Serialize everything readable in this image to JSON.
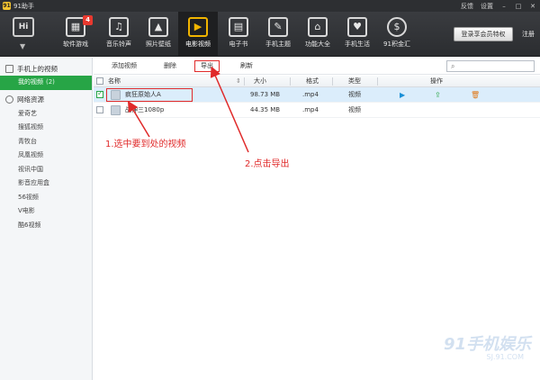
{
  "window": {
    "title": "91助手",
    "controls": [
      "反馈",
      "设置"
    ]
  },
  "toolbar": {
    "home_label": "Hi",
    "items": [
      {
        "label": "软件游戏",
        "icon": "apps-grid-icon",
        "glyph": "▦",
        "badge": "4"
      },
      {
        "label": "音乐铃声",
        "icon": "music-note-icon",
        "glyph": "♫"
      },
      {
        "label": "照片壁纸",
        "icon": "photo-icon",
        "glyph": "▲"
      },
      {
        "label": "电影视频",
        "icon": "film-icon",
        "glyph": "▶",
        "active": true
      },
      {
        "label": "电子书",
        "icon": "ebook-icon",
        "glyph": "▤"
      },
      {
        "label": "手机主题",
        "icon": "theme-icon",
        "glyph": "✎"
      },
      {
        "label": "功能大全",
        "icon": "tools-icon",
        "glyph": "⌂"
      },
      {
        "label": "手机生活",
        "icon": "heart-bag-icon",
        "glyph": "♥"
      },
      {
        "label": "91积金汇",
        "icon": "coin-icon",
        "glyph": "$"
      }
    ],
    "vip_button": "登录享会员特权",
    "register": "注册"
  },
  "sidebar": {
    "phone_section": "手机上的视频",
    "phone_items": [
      {
        "label": "我的视频",
        "count": "(2)"
      }
    ],
    "network_section": "网络资源",
    "network_items": [
      "爱奇艺",
      "搜狐视频",
      "青牧台",
      "凤凰视频",
      "视讯中国",
      "影音应用盒",
      "56视频",
      "V电影",
      "酷6视频"
    ]
  },
  "actions": {
    "add": "添加视频",
    "delete": "删除",
    "export": "导出",
    "refresh": "刷新",
    "search_placeholder": ""
  },
  "table": {
    "headers": {
      "name": "名称",
      "size": "大小",
      "format": "格式",
      "type": "类型",
      "ops": "操作"
    },
    "rows": [
      {
        "name": "疯狂原始人A",
        "size": "98.73 MB",
        "format": ".mp4",
        "type": "视频",
        "checked": true,
        "selected": true
      },
      {
        "name": "战神三1080p",
        "size": "44.35 MB",
        "format": ".mp4",
        "type": "视频",
        "checked": false,
        "selected": false
      }
    ]
  },
  "annotations": {
    "step1": "1.选中要到处的视频",
    "step2": "2.点击导出",
    "color": "#e02a2a"
  },
  "watermark": {
    "brand": "91手机娱乐",
    "url": "SJ.91.COM"
  },
  "colors": {
    "accent_green": "#27a546",
    "selection_blue": "#dbedfb",
    "toolbar_dark": "#2d2f32",
    "active_yellow": "#f0b400"
  }
}
